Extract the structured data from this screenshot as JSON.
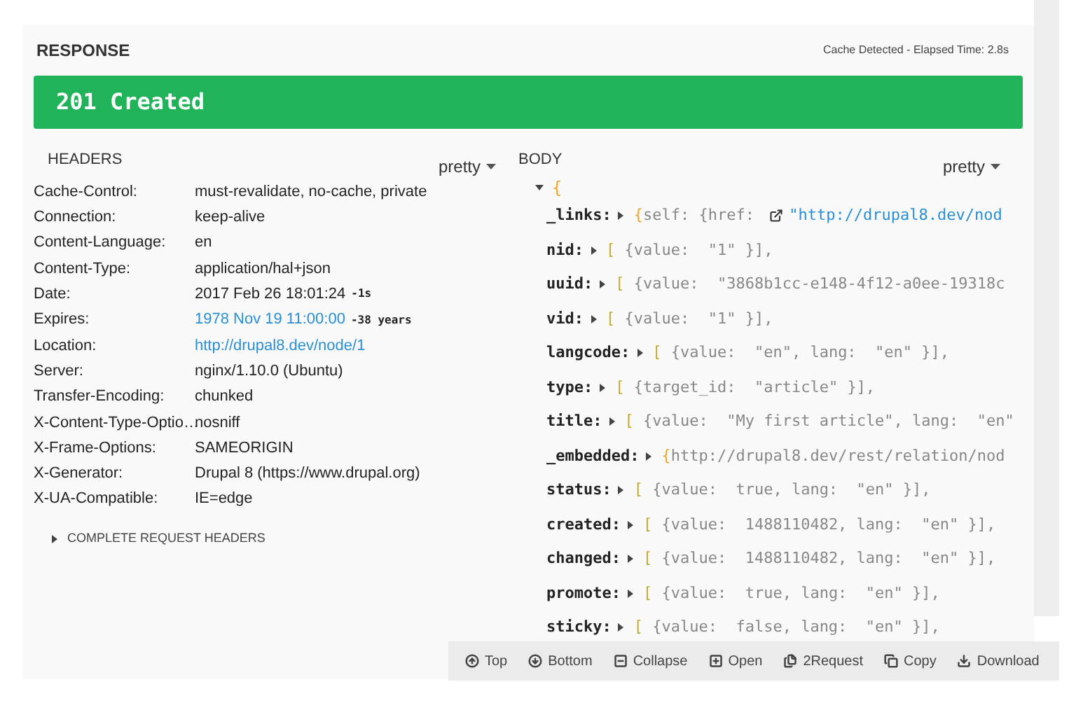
{
  "response": {
    "title": "RESPONSE",
    "cache_info": "Cache Detected - Elapsed Time: 2.8s"
  },
  "status": {
    "text": "201 Created",
    "color": "#21b35a"
  },
  "headers": {
    "title": "HEADERS",
    "format": "pretty",
    "rows": [
      {
        "name": "Cache-Control:",
        "value": "must-revalidate, no-cache, private"
      },
      {
        "name": "Connection:",
        "value": "keep-alive"
      },
      {
        "name": "Content-Language:",
        "value": "en"
      },
      {
        "name": "Content-Type:",
        "value": "application/hal+json"
      },
      {
        "name": "Date:",
        "value": "2017 Feb 26 18:01:24",
        "note": "-1s"
      },
      {
        "name": "Expires:",
        "value": "1978 Nov 19 11:00:00",
        "link": true,
        "note": "-38 years"
      },
      {
        "name": "Location:",
        "value": "http://drupal8.dev/node/1",
        "link": true
      },
      {
        "name": "Server:",
        "value": "nginx/1.10.0 (Ubuntu)"
      },
      {
        "name": "Transfer-Encoding:",
        "value": "chunked"
      },
      {
        "name": "X-Content-Type-Optio…",
        "value": "nosniff"
      },
      {
        "name": "X-Frame-Options:",
        "value": "SAMEORIGIN"
      },
      {
        "name": "X-Generator:",
        "value": "Drupal 8 (https://www.drupal.org)"
      },
      {
        "name": "X-UA-Compatible:",
        "value": "IE=edge"
      }
    ],
    "complete_toggle": {
      "label": "COMPLETE REQUEST HEADERS",
      "expanded": false
    }
  },
  "body": {
    "title": "BODY",
    "format": "pretty",
    "root": {
      "opener": "{",
      "expanded": true
    },
    "lines": [
      {
        "key": "_links:",
        "kind": "object",
        "opener": "{",
        "text": "self: {href: ",
        "link": "\"http://drupal8.dev/nod"
      },
      {
        "key": "nid:",
        "kind": "array",
        "opener": "[",
        "text": " {value:  \"1\" }],"
      },
      {
        "key": "uuid:",
        "kind": "array",
        "opener": "[",
        "text": " {value:  \"3868b1cc-e148-4f12-a0ee-19318c"
      },
      {
        "key": "vid:",
        "kind": "array",
        "opener": "[",
        "text": " {value:  \"1\" }],"
      },
      {
        "key": "langcode:",
        "kind": "array",
        "opener": "[",
        "text": " {value:  \"en\", lang:  \"en\" }],"
      },
      {
        "key": "type:",
        "kind": "array",
        "opener": "[",
        "text": " {target_id:  \"article\" }],"
      },
      {
        "key": "title:",
        "kind": "array",
        "opener": "[",
        "text": " {value:  \"My first article\", lang:  \"en\""
      },
      {
        "key": "_embedded:",
        "kind": "object",
        "opener": "{",
        "text": "http://drupal8.dev/rest/relation/nod"
      },
      {
        "key": "status:",
        "kind": "array",
        "opener": "[",
        "text": " {value:  true, lang:  \"en\" }],"
      },
      {
        "key": "created:",
        "kind": "array",
        "opener": "[",
        "text": " {value:  1488110482, lang:  \"en\" }],"
      },
      {
        "key": "changed:",
        "kind": "array",
        "opener": "[",
        "text": " {value:  1488110482, lang:  \"en\" }],"
      },
      {
        "key": "promote:",
        "kind": "array",
        "opener": "[",
        "text": " {value:  true, lang:  \"en\" }],"
      },
      {
        "key": "sticky:",
        "kind": "array",
        "opener": "[",
        "text": " {value:  false, lang:  \"en\" }],"
      }
    ]
  },
  "toolbar": [
    {
      "kind": "top",
      "label": "Top"
    },
    {
      "kind": "bottom",
      "label": "Bottom"
    },
    {
      "kind": "collapse",
      "label": "Collapse"
    },
    {
      "kind": "open",
      "label": "Open"
    },
    {
      "kind": "request",
      "label": "2Request"
    },
    {
      "kind": "copy",
      "label": "Copy"
    },
    {
      "kind": "download",
      "label": "Download"
    }
  ]
}
